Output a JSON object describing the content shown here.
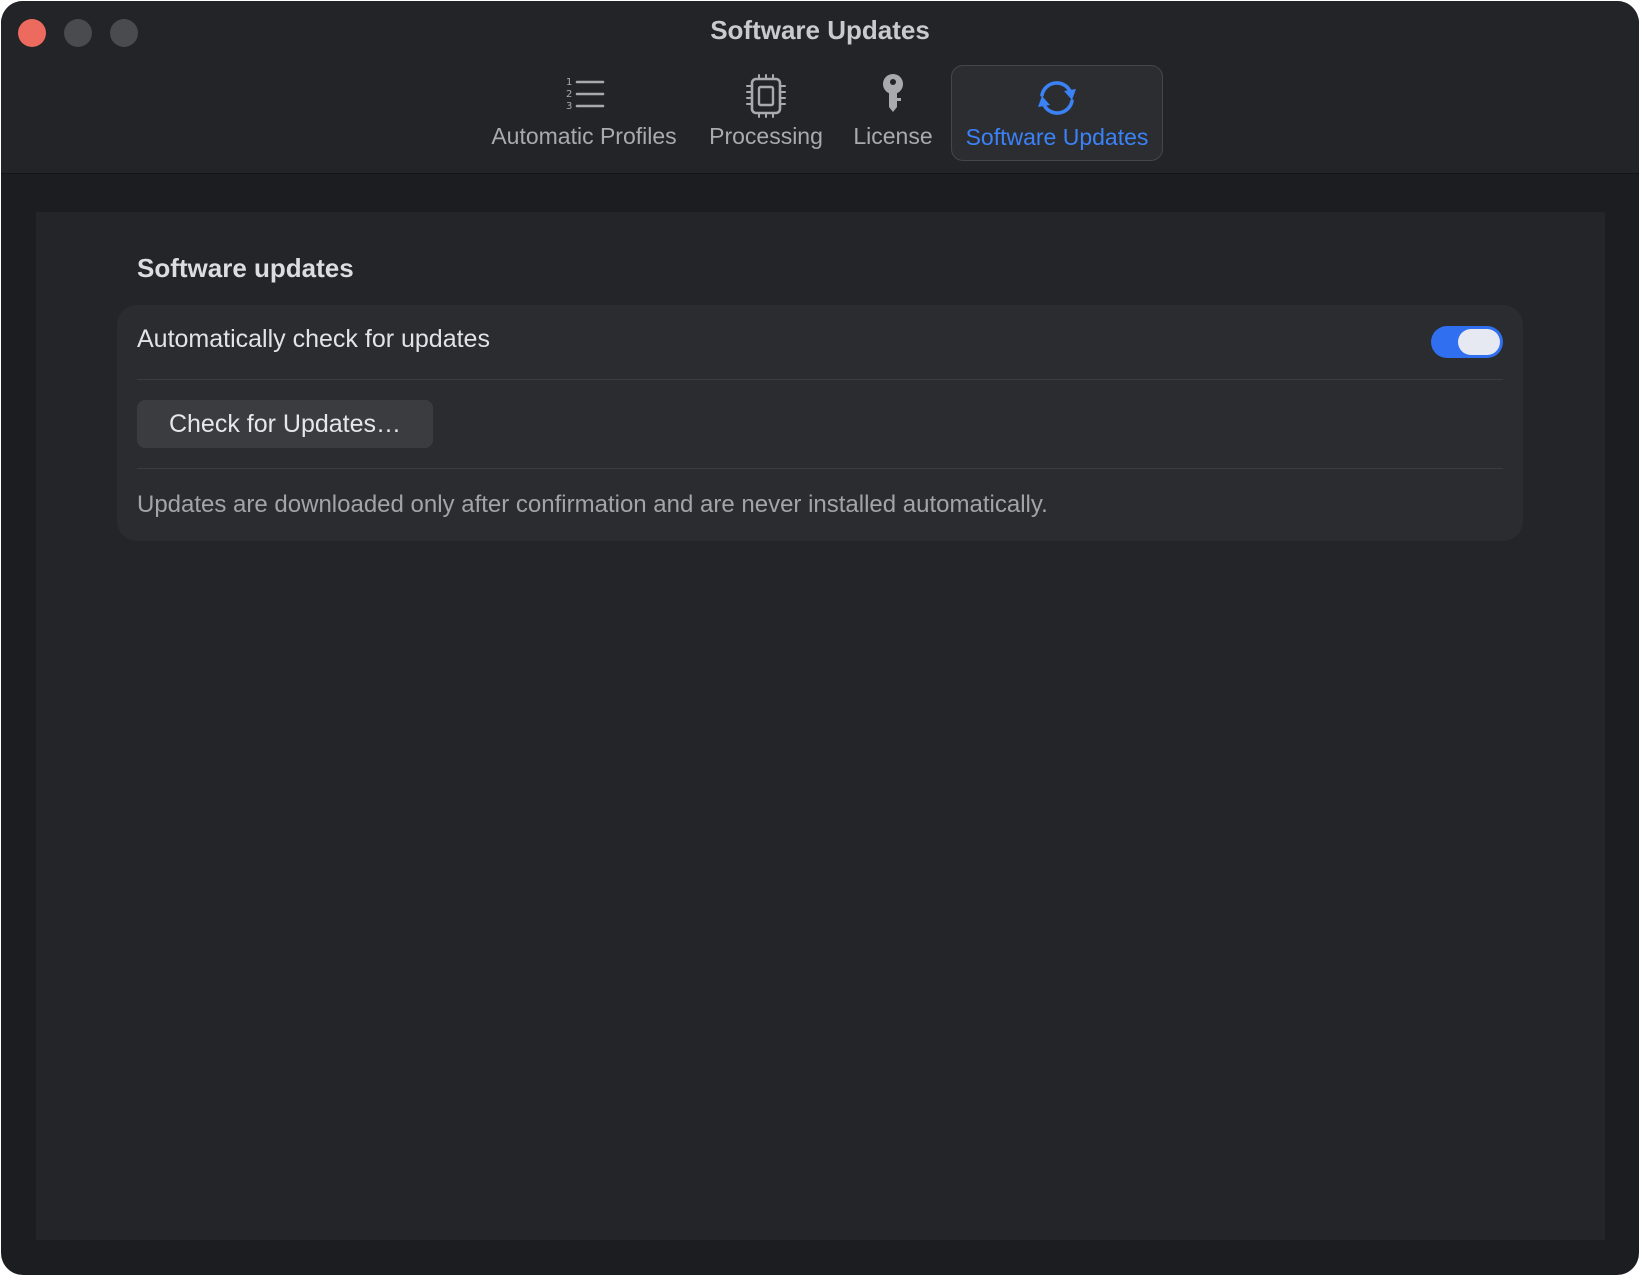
{
  "window": {
    "title": "Software Updates"
  },
  "toolbar": {
    "tabs": [
      {
        "label": "Automatic Profiles",
        "icon": "numbered-list-icon",
        "active": false
      },
      {
        "label": "Processing",
        "icon": "cpu-chip-icon",
        "active": false
      },
      {
        "label": "License",
        "icon": "key-icon",
        "active": false
      },
      {
        "label": "Software Updates",
        "icon": "sync-arrows-icon",
        "active": true
      }
    ]
  },
  "content": {
    "section_title": "Software updates",
    "auto_check_label": "Automatically check for updates",
    "auto_check_enabled": true,
    "check_button_label": "Check for Updates…",
    "note": "Updates are downloaded only after confirmation and are never installed automatically."
  },
  "colors": {
    "accent": "#3b82f6",
    "toggle_on": "#2f6ff0",
    "close_button": "#ed6a5e",
    "window_background": "#1c1d20",
    "panel_background": "#232529"
  }
}
